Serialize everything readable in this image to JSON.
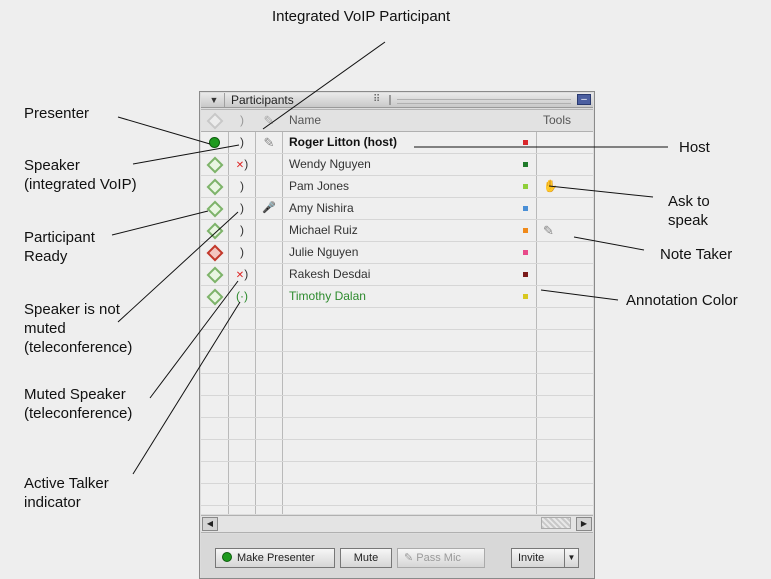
{
  "callouts": {
    "integrated_voip": "Integrated VoIP Participant",
    "presenter": "Presenter",
    "speaker_voip_1": "Speaker",
    "speaker_voip_2": "(integrated VoIP)",
    "participant_ready_1": "Participant",
    "participant_ready_2": "Ready",
    "speaker_not_muted_1": "Speaker is not",
    "speaker_not_muted_2": "muted",
    "speaker_not_muted_3": "(teleconference)",
    "muted_speaker_1": "Muted Speaker",
    "muted_speaker_2": "(teleconference)",
    "active_talker_1": "Active Talker",
    "active_talker_2": "indicator",
    "host": "Host",
    "ask_to_speak_1": "Ask to",
    "ask_to_speak_2": "speak",
    "note_taker": "Note Taker",
    "annotation_color": "Annotation Color"
  },
  "panel": {
    "title": "Participants",
    "header": {
      "name": "Name",
      "tools": "Tools"
    },
    "participants": [
      {
        "status": "presenter",
        "audio": "voip",
        "mic": "pencil",
        "name": "Roger Litton (host)",
        "bold": true,
        "name_color": "#111111",
        "annotation_color": "#d9262b",
        "tool": ""
      },
      {
        "status": "ready",
        "audio": "muted",
        "mic": "",
        "name": "Wendy Nguyen",
        "bold": false,
        "name_color": "#333333",
        "annotation_color": "#1f7a2a",
        "tool": ""
      },
      {
        "status": "ready",
        "audio": "speaker",
        "mic": "",
        "name": "Pam Jones",
        "bold": false,
        "name_color": "#333333",
        "annotation_color": "#8fcf3a",
        "tool": "hand"
      },
      {
        "status": "ready",
        "audio": "speaker",
        "mic": "mic",
        "name": "Amy Nishira",
        "bold": false,
        "name_color": "#333333",
        "annotation_color": "#4a8fd6",
        "tool": ""
      },
      {
        "status": "ready",
        "audio": "speaker",
        "mic": "",
        "name": "Michael Ruiz",
        "bold": false,
        "name_color": "#333333",
        "annotation_color": "#f08a1a",
        "tool": "pencil"
      },
      {
        "status": "not-ready",
        "audio": "speaker",
        "mic": "",
        "name": "Julie Nguyen",
        "bold": false,
        "name_color": "#333333",
        "annotation_color": "#e84a8a",
        "tool": ""
      },
      {
        "status": "ready",
        "audio": "muted",
        "mic": "",
        "name": "Rakesh Desdai",
        "bold": false,
        "name_color": "#333333",
        "annotation_color": "#7a1a1a",
        "tool": ""
      },
      {
        "status": "ready",
        "audio": "talking",
        "mic": "",
        "name": "Timothy Dalan",
        "bold": false,
        "name_color": "#2e8b2e",
        "annotation_color": "#d8c820",
        "tool": ""
      }
    ],
    "buttons": {
      "make_presenter": "Make Presenter",
      "mute": "Mute",
      "pass_mic": "Pass Mic",
      "invite": "Invite"
    }
  },
  "icons": {
    "collapse": "triangle-down-icon",
    "minimize": "minimize-icon",
    "presenter": "green-ball-icon",
    "ready": "green-diamond-icon",
    "not_ready": "red-diamond-icon",
    "speaker": "speaker-icon",
    "muted": "muted-speaker-icon",
    "talking": "active-talker-icon",
    "mic": "microphone-icon",
    "pencil": "pencil-icon",
    "hand": "raised-hand-icon"
  }
}
